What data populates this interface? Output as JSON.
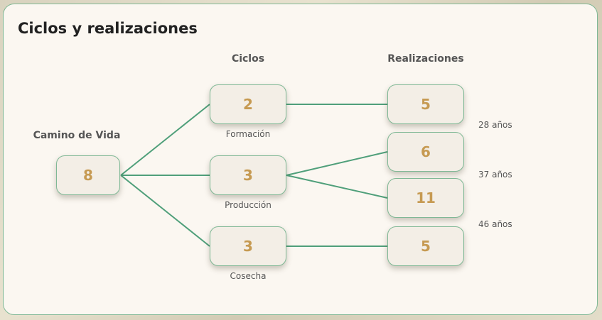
{
  "title": "Ciclos y realizaciones",
  "headers": {
    "camino": "Camino de Vida",
    "ciclos": "Ciclos",
    "realizaciones": "Realizaciones"
  },
  "life_path": "8",
  "cycles": [
    {
      "value": "2",
      "label": "Formación"
    },
    {
      "value": "3",
      "label": "Producción"
    },
    {
      "value": "3",
      "label": "Cosecha"
    }
  ],
  "realizations": [
    "5",
    "6",
    "11",
    "5"
  ],
  "ages": [
    "28 años",
    "37 años",
    "46 años"
  ],
  "colors": {
    "line": "#4f9f7a",
    "node_border": "#7fb895",
    "number": "#c69a52"
  }
}
